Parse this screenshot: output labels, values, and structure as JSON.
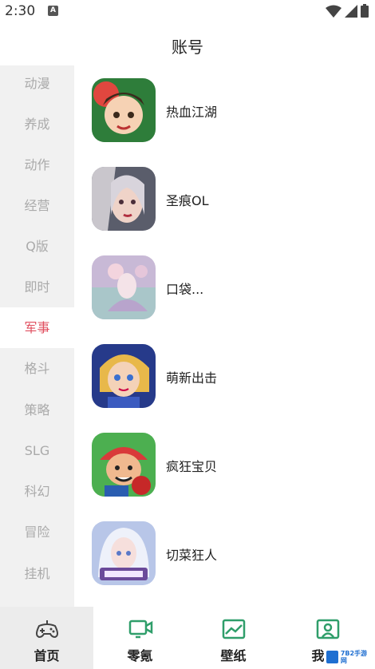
{
  "status_bar": {
    "time": "2:30",
    "notification_badge": "A"
  },
  "header": {
    "title": "账号"
  },
  "sidebar": {
    "items": [
      {
        "label": "动漫",
        "active": false
      },
      {
        "label": "养成",
        "active": false
      },
      {
        "label": "动作",
        "active": false
      },
      {
        "label": "经营",
        "active": false
      },
      {
        "label": "Q版",
        "active": false
      },
      {
        "label": "即时",
        "active": false
      },
      {
        "label": "军事",
        "active": true
      },
      {
        "label": "格斗",
        "active": false
      },
      {
        "label": "策略",
        "active": false
      },
      {
        "label": "SLG",
        "active": false
      },
      {
        "label": "科幻",
        "active": false
      },
      {
        "label": "冒险",
        "active": false
      },
      {
        "label": "挂机",
        "active": false
      }
    ],
    "active_color": "#e04f5f",
    "inactive_color": "#aaaaaa"
  },
  "games": [
    {
      "name": "热血江湖",
      "icon": "hero-girl-icon"
    },
    {
      "name": "圣痕OL",
      "icon": "elf-warrior-icon"
    },
    {
      "name": "口袋...",
      "icon": "fairy-icon"
    },
    {
      "name": "萌新出击",
      "icon": "blonde-hero-icon"
    },
    {
      "name": "疯狂宝贝",
      "icon": "cap-boy-icon"
    },
    {
      "name": "切菜狂人",
      "icon": "white-hair-girl-icon"
    }
  ],
  "tabs": [
    {
      "label": "首页",
      "icon": "gamepad-icon",
      "active": true
    },
    {
      "label": "零氪",
      "icon": "video-icon",
      "active": false
    },
    {
      "label": "壁纸",
      "icon": "image-icon",
      "active": false
    },
    {
      "label": "我",
      "icon": "profile-icon",
      "active": false
    }
  ],
  "accent_green": "#2f9e6a",
  "watermark": {
    "line1": "7B2手游网",
    "line2": ""
  }
}
